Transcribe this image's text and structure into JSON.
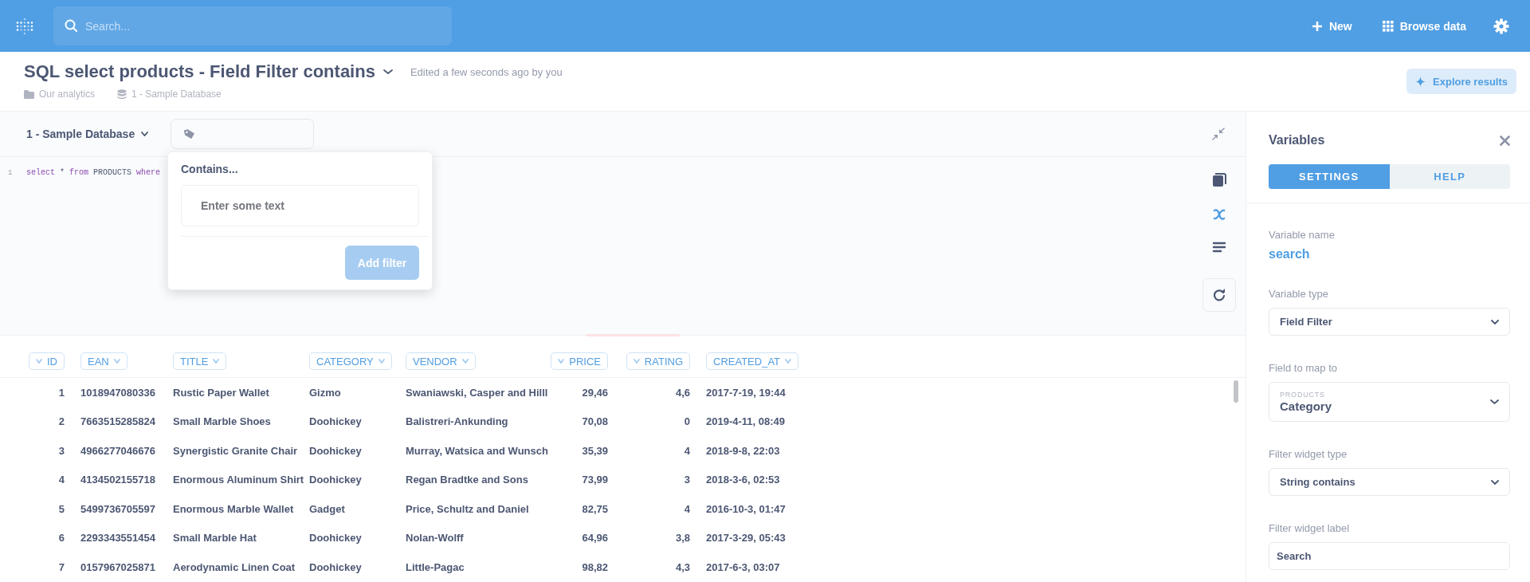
{
  "topbar": {
    "search": {
      "placeholder": "Search..."
    },
    "actions": [
      {
        "label": "New",
        "kind": "new"
      },
      {
        "label": "Browse data",
        "kind": "browse"
      }
    ]
  },
  "question": {
    "title": "SQL select products - Field Filter contains",
    "edited": "Edited a few seconds ago by you",
    "collection": "Our analytics",
    "database": "1 - Sample Database",
    "explore_button": "Explore results"
  },
  "editor": {
    "database": "1 - Sample Database",
    "code_lines": [
      {
        "number": "1",
        "tokens": [
          {
            "text": "select",
            "kind": "keyword"
          },
          {
            "text": " * ",
            "kind": "plain"
          },
          {
            "text": "from",
            "kind": "keyword"
          },
          {
            "text": " PRODUCTS ",
            "kind": "plain"
          },
          {
            "text": "where",
            "kind": "keyword"
          }
        ]
      }
    ],
    "popover": {
      "title": "Contains...",
      "placeholder": "Enter some text",
      "button": "Add filter",
      "button_disabled": true
    }
  },
  "table": {
    "columns": [
      {
        "label": "ID",
        "numeric": true
      },
      {
        "label": "EAN",
        "numeric": false
      },
      {
        "label": "TITLE",
        "numeric": false
      },
      {
        "label": "CATEGORY",
        "numeric": false
      },
      {
        "label": "VENDOR",
        "numeric": false
      },
      {
        "label": "PRICE",
        "numeric": true
      },
      {
        "label": "RATING",
        "numeric": true
      },
      {
        "label": "CREATED_AT",
        "numeric": false
      }
    ],
    "rows": [
      [
        "1",
        "1018947080336",
        "Rustic Paper Wallet",
        "Gizmo",
        "Swaniawski, Casper and Hilll",
        "29,46",
        "4,6",
        "2017-7-19, 19:44"
      ],
      [
        "2",
        "7663515285824",
        "Small Marble Shoes",
        "Doohickey",
        "Balistreri-Ankunding",
        "70,08",
        "0",
        "2019-4-11, 08:49"
      ],
      [
        "3",
        "4966277046676",
        "Synergistic Granite Chair",
        "Doohickey",
        "Murray, Watsica and Wunsch",
        "35,39",
        "4",
        "2018-9-8, 22:03"
      ],
      [
        "4",
        "4134502155718",
        "Enormous Aluminum Shirt",
        "Doohickey",
        "Regan Bradtke and Sons",
        "73,99",
        "3",
        "2018-3-6, 02:53"
      ],
      [
        "5",
        "5499736705597",
        "Enormous Marble Wallet",
        "Gadget",
        "Price, Schultz and Daniel",
        "82,75",
        "4",
        "2016-10-3, 01:47"
      ],
      [
        "6",
        "2293343551454",
        "Small Marble Hat",
        "Doohickey",
        "Nolan-Wolff",
        "64,96",
        "3,8",
        "2017-3-29, 05:43"
      ],
      [
        "7",
        "0157967025871",
        "Aerodynamic Linen Coat",
        "Doohickey",
        "Little-Pagac",
        "98,82",
        "4,3",
        "2017-6-3, 03:07"
      ]
    ]
  },
  "variables": {
    "title": "Variables",
    "tabs": [
      {
        "label": "SETTINGS",
        "selected": true
      },
      {
        "label": "HELP",
        "selected": false
      }
    ],
    "fields": [
      {
        "kind": "name",
        "label": "Variable name",
        "value": "search"
      },
      {
        "kind": "select",
        "label": "Variable type",
        "value": "Field Filter"
      },
      {
        "kind": "select",
        "label": "Field to map to",
        "group": "PRODUCTS",
        "value": "Category"
      },
      {
        "kind": "select",
        "label": "Filter widget type",
        "value": "String contains"
      },
      {
        "kind": "input",
        "label": "Filter widget label",
        "value": "Search"
      }
    ]
  }
}
